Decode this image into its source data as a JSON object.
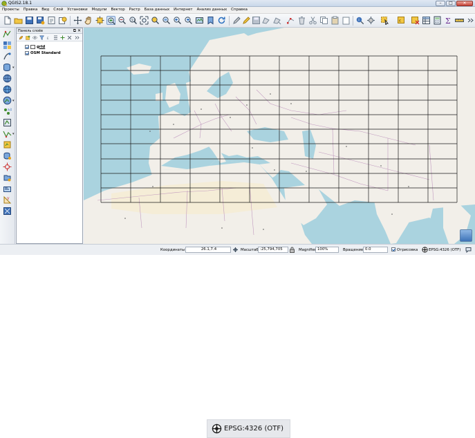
{
  "window": {
    "title": "QGIS2.18.1",
    "min_glyph": "–",
    "max_glyph": "□",
    "close_glyph": "✕"
  },
  "menu": [
    "Проекты",
    "Правка",
    "Вид",
    "Слой",
    "Установки",
    "Модули",
    "Вектор",
    "Растр",
    "База данных",
    "Интернет",
    "Анализ данных",
    "Справка"
  ],
  "layers_panel": {
    "title": "Панель слоёв",
    "controls": "⧉ ✕",
    "layers": [
      {
        "name": "grid",
        "checked": true
      },
      {
        "name": "OSM Standard",
        "checked": true
      }
    ]
  },
  "statusbar": {
    "coord_label": "Координаты",
    "coord_value": "26.1,7.4",
    "scale_label": "Масштаб",
    "scale_value": ":25,794,705",
    "magnifier_label": "Magnifier",
    "magnifier_value": "100%",
    "rotation_label": "Вращение",
    "rotation_value": "0.0",
    "render_label": "Отрисовка",
    "crs_label": "EPSG:4326 (OTF)"
  },
  "zoom_detail": {
    "crs_label": "EPSG:4326 (OTF)"
  },
  "colors": {
    "water": "#aad3df",
    "land": "#f2efe9",
    "grid_line": "#1a1a1a",
    "border_purple": "#b88ab8"
  }
}
